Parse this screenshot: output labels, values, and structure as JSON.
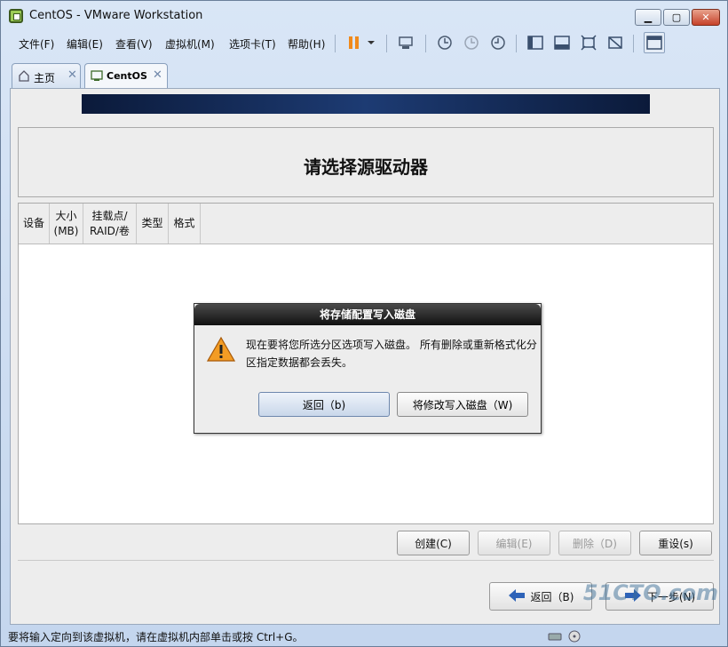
{
  "window": {
    "title": "CentOS - VMware Workstation"
  },
  "menu": [
    {
      "label": "文件(F)"
    },
    {
      "label": "编辑(E)"
    },
    {
      "label": "查看(V)"
    },
    {
      "label": "虚拟机(M)"
    },
    {
      "label": "选项卡(T)"
    },
    {
      "label": "帮助(H)"
    }
  ],
  "tabs": [
    {
      "label": "主页"
    },
    {
      "label": "CentOS"
    }
  ],
  "installer": {
    "heading": "请选择源驱动器",
    "columns": [
      {
        "label": "设备"
      },
      {
        "label": "大小\n(MB)"
      },
      {
        "label": "挂载点/\nRAID/卷"
      },
      {
        "label": "类型"
      },
      {
        "label": "格式"
      }
    ],
    "actions": {
      "create": "创建(C)",
      "edit": "编辑(E)",
      "delete": "删除（D)",
      "reset": "重设(s)"
    },
    "back": "返回（B)",
    "next": "下一步(N)"
  },
  "dialog": {
    "title": "将存储配置写入磁盘",
    "message": "现在要将您所选分区选项写入磁盘。 所有删除或重新格式化分区指定数据都会丢失。",
    "go_back": "返回（b)",
    "write": "将修改写入磁盘（W)"
  },
  "status": {
    "text": "要将输入定向到该虚拟机，请在虚拟机内部单击或按 Ctrl+G。"
  },
  "watermark": "51CTO.com",
  "colors": {
    "dialog_title_bg": "#111111",
    "banner": "#0b1a3a",
    "close_button": "#c6422a"
  }
}
